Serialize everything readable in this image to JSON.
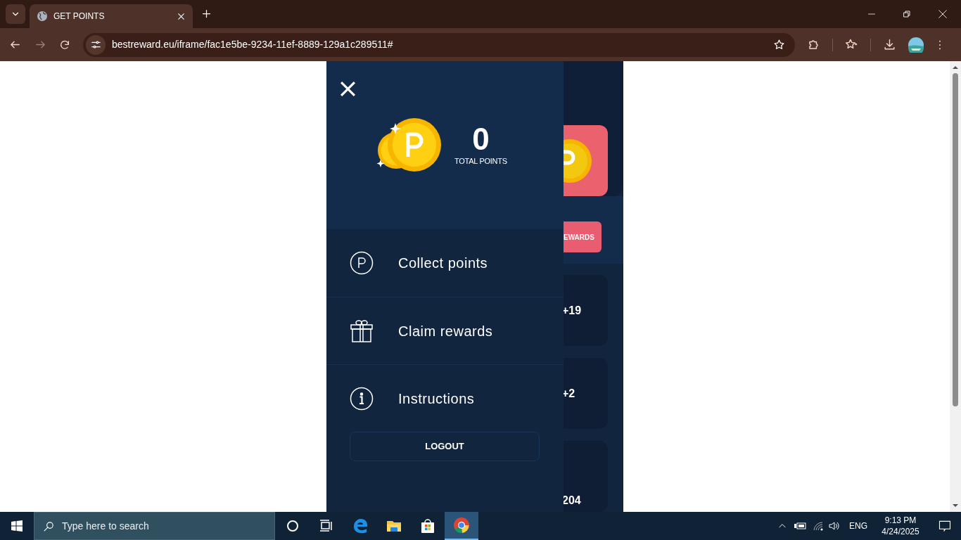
{
  "browser": {
    "tabs": [
      {
        "title": "GET POINTS",
        "selected": true
      }
    ],
    "url": "bestreward.eu/iframe/fac1e5be-9234-11ef-8889-129a1c289511#"
  },
  "drawer": {
    "points_value": "0",
    "points_label": "TOTAL POINTS",
    "menu": [
      {
        "kind": "points",
        "label": "Collect points"
      },
      {
        "kind": "gift",
        "label": "Claim rewards"
      },
      {
        "kind": "info",
        "label": "Instructions"
      }
    ],
    "logout": "LOGOUT"
  },
  "background": {
    "rewards_button": "EWARDS",
    "cards": [
      "+19",
      "+2",
      "204"
    ]
  },
  "taskbar": {
    "search_placeholder": "Type here to search",
    "apps": [
      {
        "kind": "cortana",
        "selected": false
      },
      {
        "kind": "taskview",
        "selected": false
      },
      {
        "kind": "edge",
        "selected": false
      },
      {
        "kind": "explorer",
        "selected": false
      },
      {
        "kind": "store",
        "selected": false
      },
      {
        "kind": "chrome",
        "selected": true
      }
    ],
    "language": "ENG",
    "time": "9:13 PM",
    "date": "4/24/2025"
  }
}
